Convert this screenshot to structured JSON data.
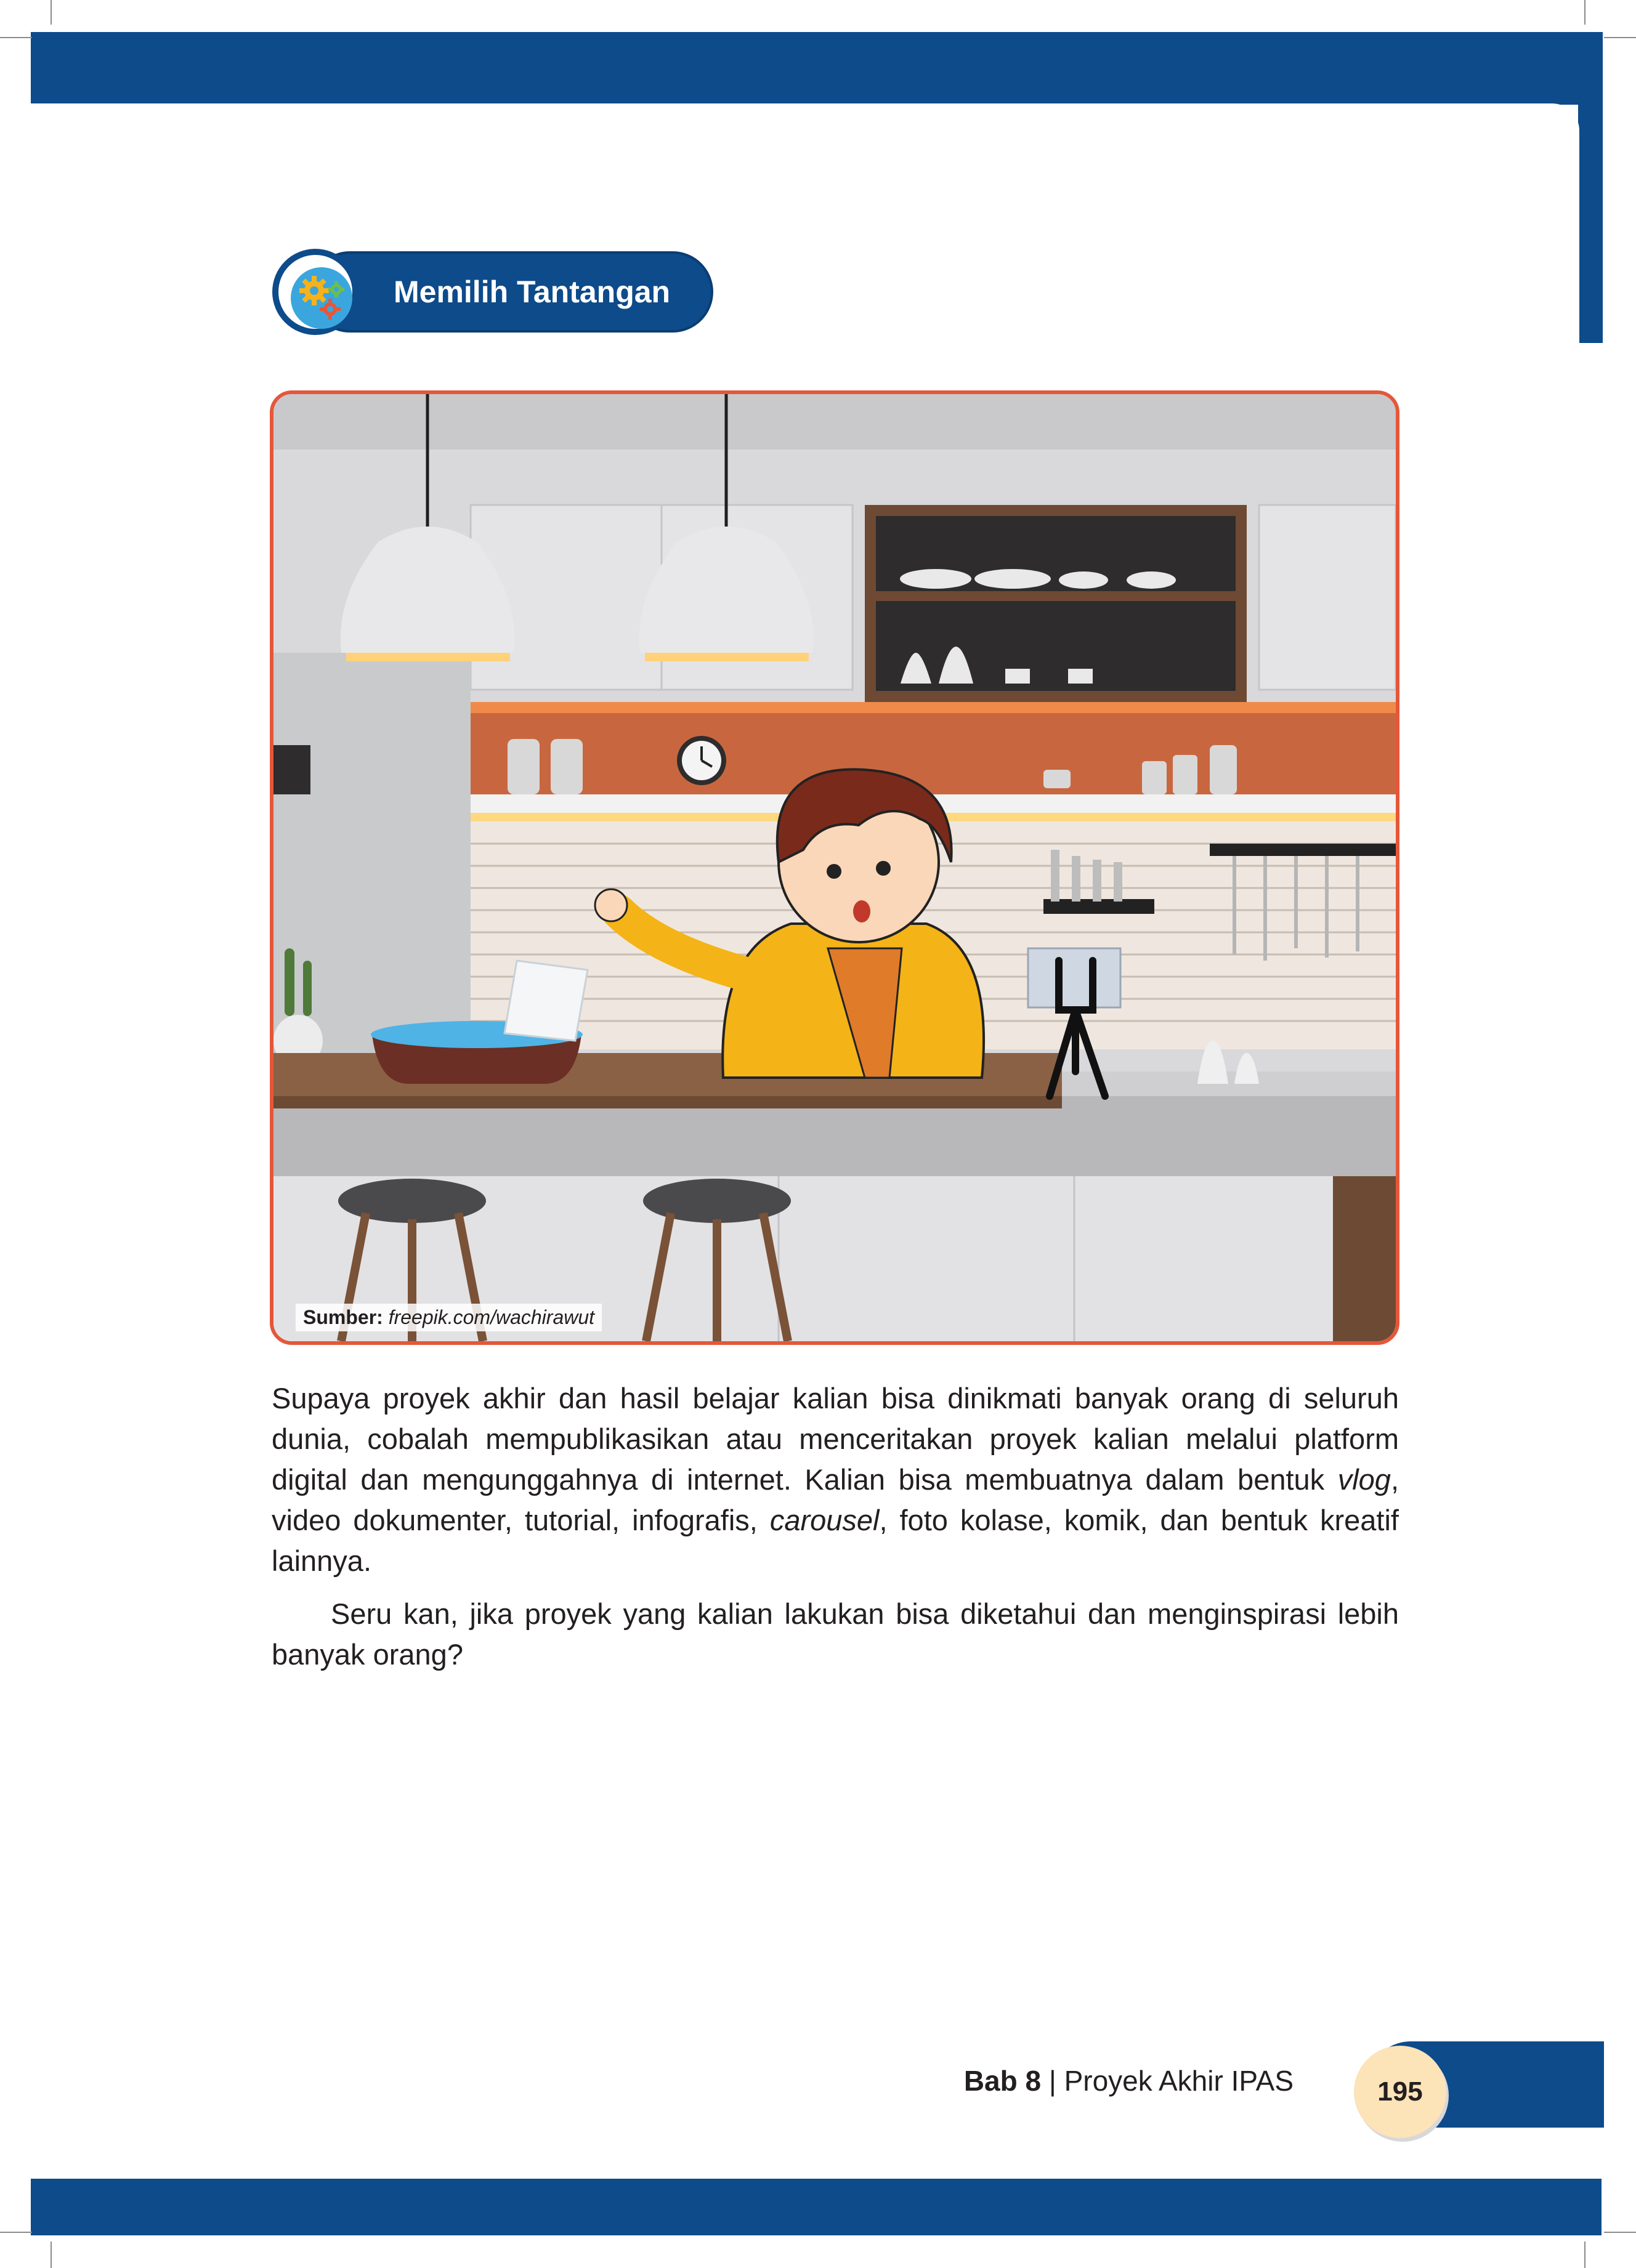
{
  "section": {
    "badge_label": "Memilih Tantangan",
    "icon": "gears-icon"
  },
  "illustration": {
    "source_label": "Sumber:",
    "source_value": "freepik.com/wachirawut"
  },
  "body": {
    "p1_a": "Supaya proyek akhir dan hasil belajar kalian bisa dinikmati banyak orang di seluruh dunia, cobalah mempublikasikan atau menceritakan proyek kalian melalui platform digital dan mengunggahnya di internet. Kalian bisa membuatnya dalam bentuk ",
    "p1_vlog": "vlog",
    "p1_b": ", video dokumenter, tutorial, infografis, ",
    "p1_carousel": "carousel",
    "p1_c": ", foto kolase, komik, dan bentuk kreatif lainnya.",
    "p2": "Seru kan, jika proyek yang kalian lakukan bisa diketahui dan menginspirasi lebih banyak orang?"
  },
  "footer": {
    "chapter_bold": "Bab 8",
    "separator": " | ",
    "chapter_title": "Proyek Akhir IPAS",
    "page_number": "195"
  },
  "colors": {
    "brand_blue": "#0d4b8b",
    "frame_orange": "#e5573a",
    "page_badge": "#fce3b8"
  }
}
